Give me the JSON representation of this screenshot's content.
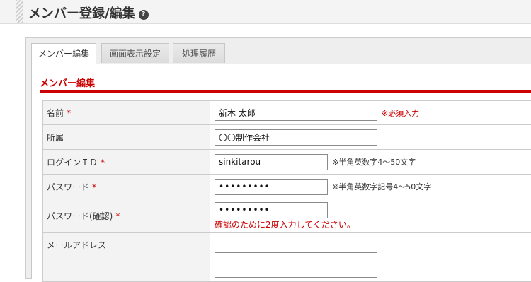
{
  "header": {
    "title": "メンバー登録/編集",
    "help_icon": "question-circle-icon"
  },
  "tabs": [
    {
      "label": "メンバー編集",
      "active": true
    },
    {
      "label": "画面表示設定",
      "active": false
    },
    {
      "label": "処理履歴",
      "active": false
    }
  ],
  "section": {
    "title": "メンバー編集"
  },
  "required_mark": "*",
  "fields": {
    "name": {
      "label": "名前",
      "value": "新木 太郎",
      "hint": "※必須入力"
    },
    "affiliation": {
      "label": "所属",
      "value": "〇〇制作会社"
    },
    "login_id": {
      "label": "ログインＩＤ",
      "value": "sinkitarou",
      "hint": "※半角英数字4～50文字"
    },
    "password": {
      "label": "パスワード",
      "value": "•••••••••",
      "hint": "※半角英数字記号4～50文字"
    },
    "password_confirm": {
      "label": "パスワード(確認)",
      "value": "•••••••••",
      "note": "確認のために2度入力してください。"
    },
    "email": {
      "label": "メールアドレス",
      "value": ""
    },
    "extra": {
      "label": "",
      "value": ""
    }
  },
  "colors": {
    "accent": "#cc0000",
    "label_bg": "#f3f3f3",
    "border": "#cccccc"
  }
}
